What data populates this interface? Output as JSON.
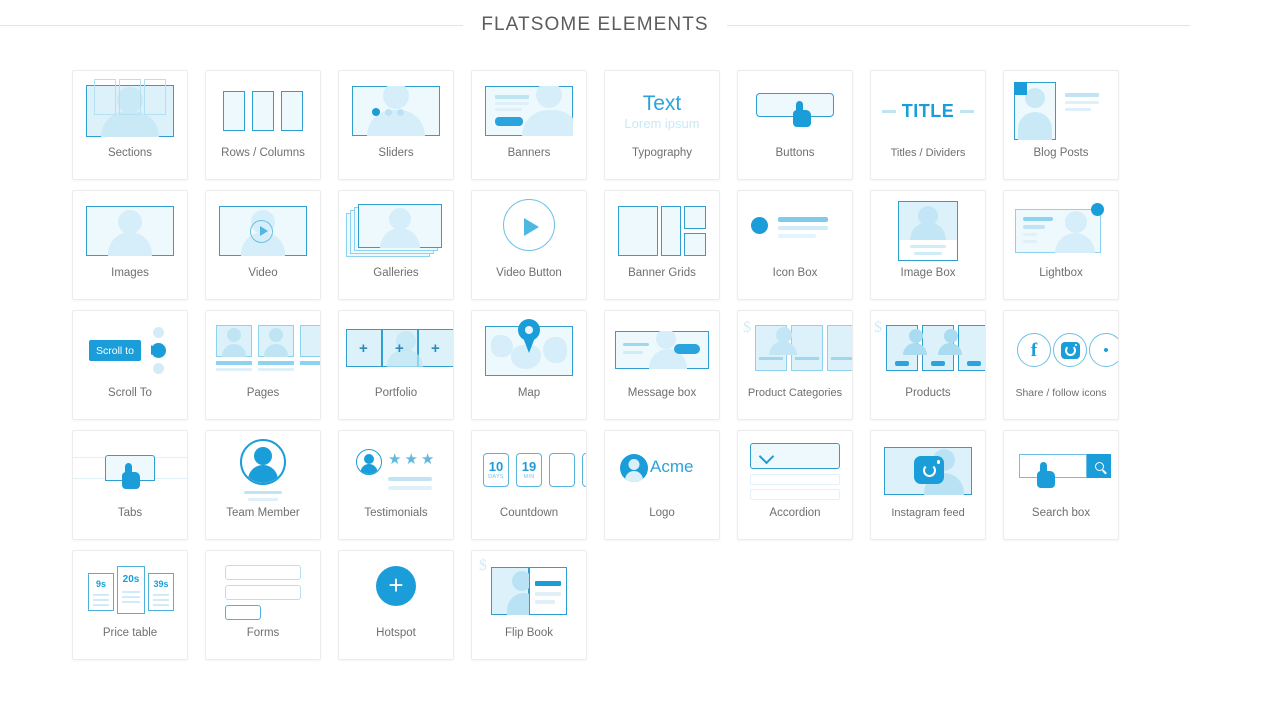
{
  "header": {
    "title": "FLATSOME ELEMENTS"
  },
  "elements": [
    {
      "id": "sections",
      "label": "Sections",
      "icon": "sections-icon"
    },
    {
      "id": "rows-columns",
      "label": "Rows / Columns",
      "icon": "columns-icon"
    },
    {
      "id": "sliders",
      "label": "Sliders",
      "icon": "slider-icon"
    },
    {
      "id": "banners",
      "label": "Banners",
      "icon": "banner-icon"
    },
    {
      "id": "typography",
      "label": "Typography",
      "icon": "text-icon",
      "sample_title": "Text",
      "sample_sub": "Lorem ipsum"
    },
    {
      "id": "buttons",
      "label": "Buttons",
      "icon": "button-pointer-icon"
    },
    {
      "id": "titles-dividers",
      "label": "Titles / Dividers",
      "icon": "title-divider-icon",
      "sample_title": "TITLE"
    },
    {
      "id": "blog-posts",
      "label": "Blog Posts",
      "icon": "blog-post-icon"
    },
    {
      "id": "images",
      "label": "Images",
      "icon": "image-icon"
    },
    {
      "id": "video",
      "label": "Video",
      "icon": "video-play-icon"
    },
    {
      "id": "galleries",
      "label": "Galleries",
      "icon": "gallery-stack-icon"
    },
    {
      "id": "video-button",
      "label": "Video Button",
      "icon": "play-circle-icon"
    },
    {
      "id": "banner-grids",
      "label": "Banner Grids",
      "icon": "banner-grid-icon"
    },
    {
      "id": "icon-box",
      "label": "Icon Box",
      "icon": "icon-box-icon"
    },
    {
      "id": "image-box",
      "label": "Image Box",
      "icon": "image-box-icon"
    },
    {
      "id": "lightbox",
      "label": "Lightbox",
      "icon": "lightbox-icon"
    },
    {
      "id": "scroll-to",
      "label": "Scroll To",
      "icon": "scroll-to-icon",
      "badge": "Scroll to"
    },
    {
      "id": "pages",
      "label": "Pages",
      "icon": "pages-icon"
    },
    {
      "id": "portfolio",
      "label": "Portfolio",
      "icon": "portfolio-icon",
      "plus": "+"
    },
    {
      "id": "map",
      "label": "Map",
      "icon": "map-pin-icon"
    },
    {
      "id": "message-box",
      "label": "Message box",
      "icon": "message-box-icon"
    },
    {
      "id": "product-categories",
      "label": "Product Categories",
      "icon": "product-categories-icon",
      "currency": "$"
    },
    {
      "id": "products",
      "label": "Products",
      "icon": "products-icon",
      "currency": "$"
    },
    {
      "id": "share-follow-icons",
      "label": "Share / follow icons",
      "icon": "social-icons-icon",
      "social": [
        "facebook-icon",
        "instagram-icon",
        "twitter-icon"
      ]
    },
    {
      "id": "tabs",
      "label": "Tabs",
      "icon": "tabs-pointer-icon"
    },
    {
      "id": "team-member",
      "label": "Team Member",
      "icon": "team-member-icon"
    },
    {
      "id": "testimonials",
      "label": "Testimonials",
      "icon": "testimonial-stars-icon",
      "stars": 3
    },
    {
      "id": "countdown",
      "label": "Countdown",
      "icon": "countdown-icon",
      "units": [
        {
          "value": "10",
          "label": "DAYS"
        },
        {
          "value": "19",
          "label": "MIN"
        }
      ]
    },
    {
      "id": "logo",
      "label": "Logo",
      "icon": "logo-icon",
      "brand": "Acme"
    },
    {
      "id": "accordion",
      "label": "Accordion",
      "icon": "accordion-chevron-icon"
    },
    {
      "id": "instagram-feed",
      "label": "Instagram feed",
      "icon": "instagram-feed-icon"
    },
    {
      "id": "search-box",
      "label": "Search box",
      "icon": "search-box-icon"
    },
    {
      "id": "price-table",
      "label": "Price table",
      "icon": "price-table-icon",
      "prices": [
        "9s",
        "20s",
        "39s"
      ]
    },
    {
      "id": "forms",
      "label": "Forms",
      "icon": "form-fields-icon"
    },
    {
      "id": "hotspot",
      "label": "Hotspot",
      "icon": "plus-circle-icon",
      "plus": "+"
    },
    {
      "id": "flip-book",
      "label": "Flip Book",
      "icon": "flip-book-icon",
      "currency": "$"
    }
  ],
  "colors": {
    "accent": "#1a9dd9",
    "accent_light": "#8dd2ee",
    "fill_light": "#eef9fd",
    "fill_mid": "#c9e9f6",
    "caption": "#6f6f6f",
    "card_border": "#ececec",
    "title": "#5c5c5c"
  }
}
